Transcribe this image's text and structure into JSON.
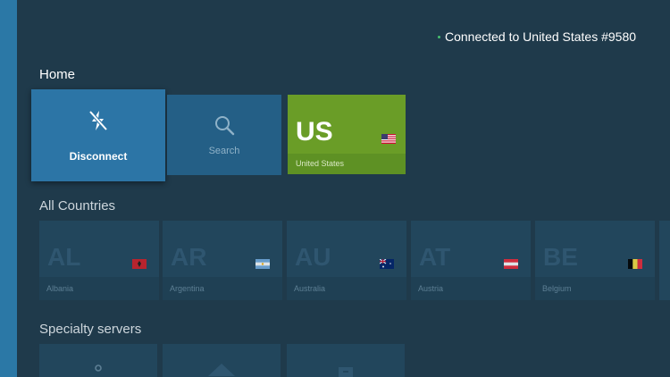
{
  "status": {
    "text": "Connected to United States #9580",
    "dot_color": "#46c06e"
  },
  "sections": {
    "home": "Home",
    "all_countries": "All Countries",
    "specialty": "Specialty servers"
  },
  "home_tiles": {
    "disconnect": {
      "label": "Disconnect",
      "icon": "power-off-bolt-icon"
    },
    "search": {
      "label": "Search",
      "icon": "search-icon"
    },
    "current": {
      "code": "US",
      "name": "United States",
      "icon": "flag-us-icon"
    }
  },
  "countries": [
    {
      "code": "AL",
      "name": "Albania",
      "icon": "flag-al-icon"
    },
    {
      "code": "AR",
      "name": "Argentina",
      "icon": "flag-ar-icon"
    },
    {
      "code": "AU",
      "name": "Australia",
      "icon": "flag-au-icon"
    },
    {
      "code": "AT",
      "name": "Austria",
      "icon": "flag-at-icon"
    },
    {
      "code": "BE",
      "name": "Belgium",
      "icon": "flag-be-icon"
    }
  ],
  "specialty": [
    {
      "icon": "location-pin-icon"
    },
    {
      "icon": "diamond-icon"
    },
    {
      "icon": "server-icon"
    }
  ],
  "colors": {
    "background": "#1f3a4b",
    "rail": "#2b78a6",
    "focus_tile": "#2c75a6",
    "connected_tile": "#6a9d27"
  }
}
